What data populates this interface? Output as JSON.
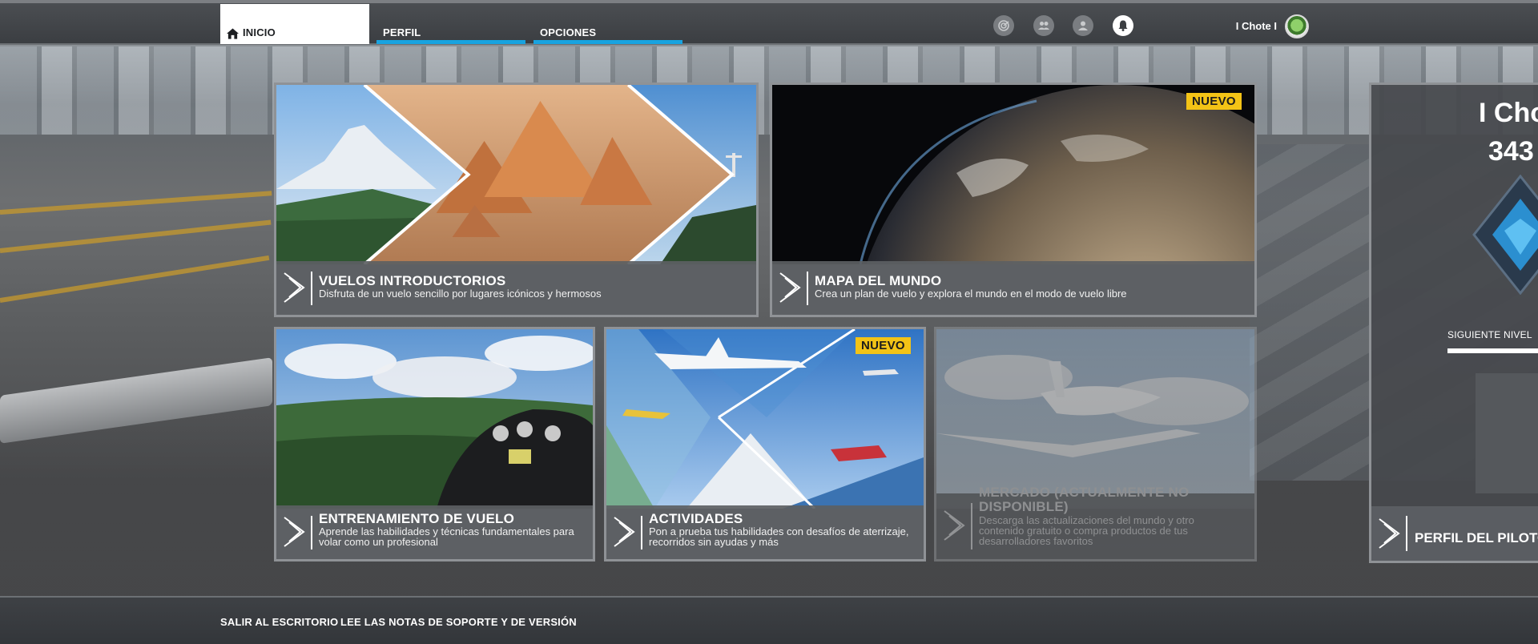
{
  "nav": {
    "tabs": [
      {
        "label": "INICIO",
        "active": true
      },
      {
        "label": "PERFIL",
        "active": false
      },
      {
        "label": "OPCIONES",
        "active": false
      }
    ],
    "icons": [
      "radar-icon",
      "friends-icon",
      "account-icon",
      "notification-icon"
    ],
    "username": "I Chote I",
    "accent_color": "#18a3e0"
  },
  "cards": [
    {
      "title": "VUELOS INTRODUCTORIOS",
      "description": [
        "Disfruta de un vuelo sencillo por lugares icónicos y hermosos"
      ],
      "badge": "",
      "available": true
    },
    {
      "title": "MAPA DEL MUNDO",
      "description": [
        "Crea un plan de vuelo y explora el mundo en el modo de vuelo libre"
      ],
      "badge": "NUEVO",
      "available": true
    },
    {
      "title": "ENTRENAMIENTO DE VUELO",
      "description": [
        "Aprende las habilidades y técnicas fundamentales para",
        "volar como un profesional"
      ],
      "badge": "",
      "available": true
    },
    {
      "title": "ACTIVIDADES",
      "description": [
        "Pon a prueba tus habilidades con desafíos de aterrizaje,",
        "recorridos sin ayudas y más"
      ],
      "badge": "NUEVO",
      "available": true
    },
    {
      "title": [
        "MERCADO (ACTUALMENTE NO",
        "DISPONIBLE)"
      ],
      "description": [
        "Descarga las actualizaciones del mundo y otro",
        "contenido gratuito o compra productos de tus",
        "desarrolladores favoritos"
      ],
      "badge": "",
      "available": false
    }
  ],
  "pilot": {
    "name": "I Cho",
    "xp": "343",
    "next_level_label": "SIGUIENTE NIVEL",
    "panel_label": "PERFIL DEL PILOTO"
  },
  "footer": {
    "links": [
      "SALIR AL ESCRITORIO",
      "LEE LAS NOTAS DE SOPORTE Y DE VERSIÓN"
    ]
  },
  "colors": {
    "badge": "#f3c316",
    "accent": "#18a3e0"
  }
}
